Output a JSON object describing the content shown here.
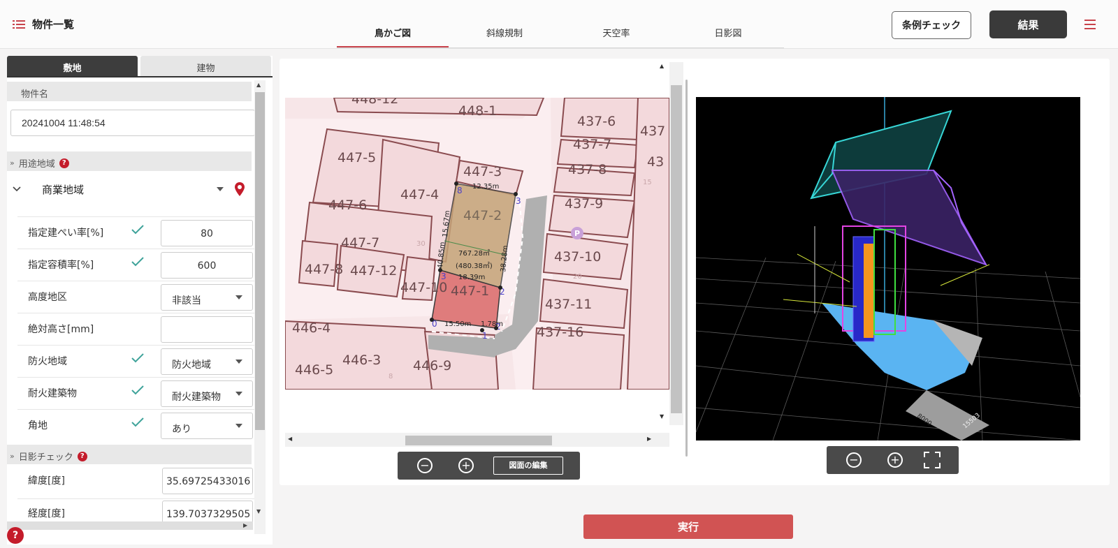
{
  "header": {
    "title": "物件一覧",
    "tabs": [
      "鳥かご図",
      "斜線規制",
      "天空率",
      "日影図"
    ],
    "active_tab": "鳥かご図",
    "ordinance_check": "条例チェック",
    "results": "結果"
  },
  "sidebar": {
    "tabs": [
      "敷地",
      "建物"
    ],
    "active_tab": "敷地",
    "property_name_label": "物件名",
    "property_name_value": "20241004 11:48:54",
    "zoning_section": "用途地域",
    "zoning_value": "商業地域",
    "fields": [
      {
        "label": "指定建ぺい率[%]",
        "value": "80",
        "checked": true,
        "kind": "number"
      },
      {
        "label": "指定容積率[%]",
        "value": "600",
        "checked": true,
        "kind": "number"
      },
      {
        "label": "高度地区",
        "value": "非該当",
        "checked": false,
        "kind": "select"
      },
      {
        "label": "絶対高さ[mm]",
        "value": "",
        "checked": false,
        "kind": "number"
      },
      {
        "label": "防火地域",
        "value": "防火地域",
        "checked": true,
        "kind": "select"
      },
      {
        "label": "耐火建築物",
        "value": "耐火建築物",
        "checked": true,
        "kind": "select"
      },
      {
        "label": "角地",
        "value": "あり",
        "checked": true,
        "kind": "select"
      }
    ],
    "shadow_section": "日影チェック",
    "latitude_label": "緯度[度]",
    "latitude_value": "35.69725433016",
    "longitude_label": "経度[度]",
    "longitude_value": "139.7037329505",
    "help_mark": "?"
  },
  "map": {
    "lot_labels": [
      "448-12",
      "448-1",
      "447-5",
      "447-3",
      "447-4",
      "447-6",
      "447-2",
      "447-7",
      "447-8",
      "447-12",
      "447-10",
      "447-1",
      "446-4",
      "446-3",
      "446-9",
      "446-5",
      "437-6",
      "437-7",
      "437-8",
      "437-9",
      "437-10",
      "437-11",
      "437-16",
      "437",
      "43"
    ],
    "small_numbers": [
      "15",
      "30",
      "20",
      "8"
    ],
    "dimensions": [
      "12.35m",
      "15.67m",
      "38.28m",
      "40.85m",
      "18.39m",
      "15.50m",
      "1.78m",
      "767.28㎡",
      "(480.38㎡)"
    ],
    "vertex_labels": [
      "0",
      "1",
      "2",
      "3",
      "3",
      "2",
      "8"
    ],
    "parking_mark": "P",
    "tools": {
      "zoom_out": "−",
      "zoom_in": "+",
      "edit": "図面の編集"
    }
  },
  "view3d": {
    "dimension_labels": [
      "8000",
      "15503"
    ],
    "tools": {
      "zoom_out": "−",
      "zoom_in": "+"
    }
  },
  "run_button": "実行",
  "colors": {
    "accent": "#c8434b",
    "run": "#d15353",
    "dark": "#3a3a3a",
    "map_bg": "#f7e6e8",
    "lot_line": "#8a4b4f",
    "site_fill": "#c4a277",
    "road": "#a9a9a9",
    "envelope_cyan": "#2ec4c4",
    "envelope_purple": "#a463ff",
    "ground_blue": "#5ab4f2"
  },
  "icons": [
    "list-icon",
    "hamburger-menu-icon",
    "chevron-down-icon",
    "caret-down-icon",
    "map-pin-icon",
    "checkmark-icon",
    "help-icon",
    "zoom-out-icon",
    "zoom-in-icon",
    "fullscreen-icon"
  ]
}
